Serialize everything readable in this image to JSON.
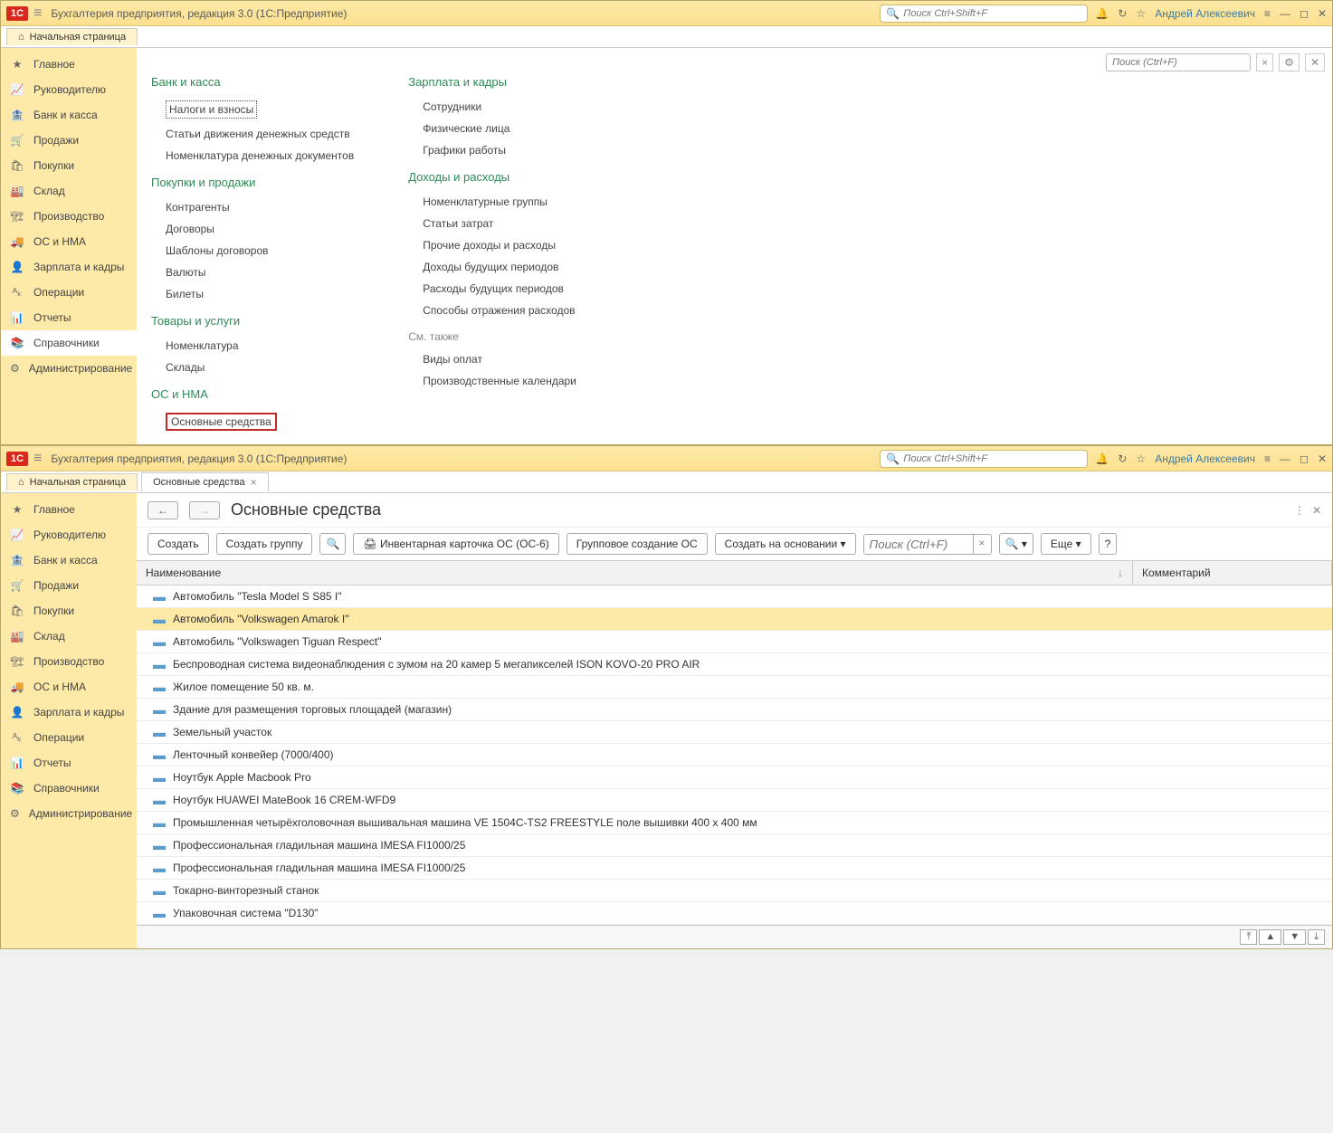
{
  "app": {
    "title": "Бухгалтерия предприятия, редакция 3.0  (1С:Предприятие)",
    "search_placeholder": "Поиск Ctrl+Shift+F",
    "user": "Андрей Алексеевич"
  },
  "tabs_top1": {
    "home": "Начальная страница"
  },
  "tabs_top2": {
    "home": "Начальная страница",
    "os": "Основные средства"
  },
  "sidebar": {
    "items": [
      "Главное",
      "Руководителю",
      "Банк и касса",
      "Продажи",
      "Покупки",
      "Склад",
      "Производство",
      "ОС и НМА",
      "Зарплата и кадры",
      "Операции",
      "Отчеты",
      "Справочники",
      "Администрирование"
    ]
  },
  "top_search1": {
    "placeholder": "Поиск (Ctrl+F)"
  },
  "sections": {
    "bank": {
      "title": "Банк и касса",
      "items": [
        "Налоги и взносы",
        "Статьи движения денежных средств",
        "Номенклатура денежных документов"
      ]
    },
    "pokupki": {
      "title": "Покупки и продажи",
      "items": [
        "Контрагенты",
        "Договоры",
        "Шаблоны договоров",
        "Валюты",
        "Билеты"
      ]
    },
    "tovary": {
      "title": "Товары и услуги",
      "items": [
        "Номенклатура",
        "Склады"
      ]
    },
    "os": {
      "title": "ОС и НМА",
      "items": [
        "Основные средства"
      ]
    },
    "zarplata": {
      "title": "Зарплата и кадры",
      "items": [
        "Сотрудники",
        "Физические лица",
        "Графики работы"
      ]
    },
    "dohody": {
      "title": "Доходы и расходы",
      "items": [
        "Номенклатурные группы",
        "Статьи затрат",
        "Прочие доходы и расходы",
        "Доходы будущих периодов",
        "Расходы будущих периодов",
        "Способы отражения расходов"
      ]
    },
    "see_also": "См. также",
    "see_also_items": [
      "Виды оплат",
      "Производственные календари"
    ]
  },
  "page2": {
    "title": "Основные средства",
    "toolbar": {
      "create": "Создать",
      "create_group": "Создать группу",
      "inv_card": "Инвентарная карточка ОС (ОС-6)",
      "group_create": "Групповое создание ОС",
      "create_based": "Создать на основании",
      "search_placeholder": "Поиск (Ctrl+F)",
      "more": "Еще"
    },
    "columns": {
      "name": "Наименование",
      "comment": "Комментарий"
    },
    "rows": [
      "Автомобиль \"Tesla Model S S85 I\"",
      "Автомобиль \"Volkswagen Amarok I\"",
      "Автомобиль \"Volkswagen Tiguan Respect\"",
      "Беспроводная система видеонаблюдения с зумом на 20 камер 5 мегапикселей ISON KOVO-20 PRO AIR",
      "Жилое помещение 50 кв. м.",
      "Здание для размещения торговых площадей (магазин)",
      "Земельный участок",
      "Ленточный конвейер (7000/400)",
      "Ноутбук Apple Macbook Pro",
      "Ноутбук HUAWEI MateBook 16 CREM-WFD9",
      "Промышленная четырёхголовочная вышивальная машина VE 1504C-TS2 FREESTYLE поле вышивки 400 x 400 мм",
      "Профессиональная гладильная машина IMESA FI1000/25",
      "Профессиональная гладильная машина IMESA FI1000/25",
      "Токарно-винторезный станок",
      "Упаковочная система \"D130\""
    ],
    "selected_index": 1
  }
}
